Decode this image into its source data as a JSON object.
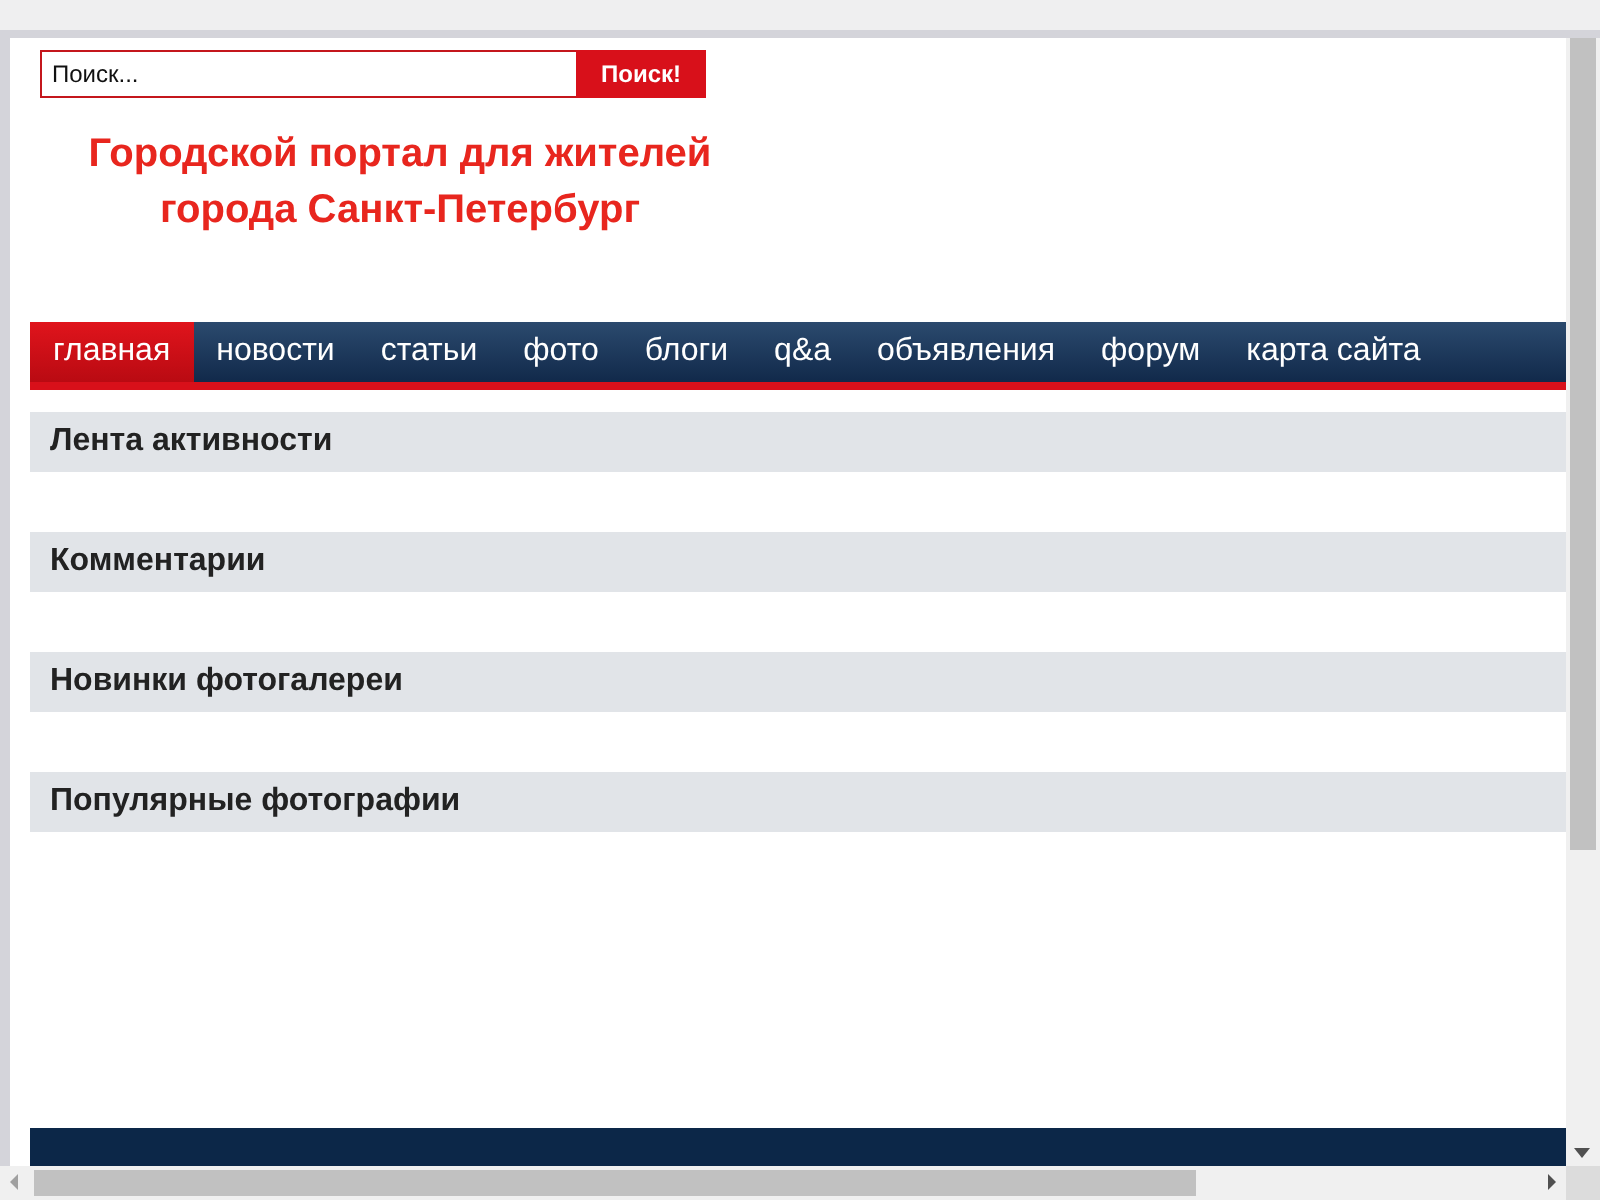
{
  "search": {
    "placeholder": "Поиск...",
    "button": "Поиск!"
  },
  "site_title": [
    "Городской портал для жителей",
    "города Санкт-Петербург"
  ],
  "nav": [
    {
      "label": "главная",
      "selected": true
    },
    {
      "label": "новости",
      "selected": false
    },
    {
      "label": "статьи",
      "selected": false
    },
    {
      "label": "фото",
      "selected": false
    },
    {
      "label": "блоги",
      "selected": false
    },
    {
      "label": "q&a",
      "selected": false
    },
    {
      "label": "объявления",
      "selected": false
    },
    {
      "label": "форум",
      "selected": false
    },
    {
      "label": "карта сайта",
      "selected": false
    }
  ],
  "sections": [
    "Лента активности",
    "Комментарии",
    "Новинки фотогалереи",
    "Популярные фотографии"
  ]
}
